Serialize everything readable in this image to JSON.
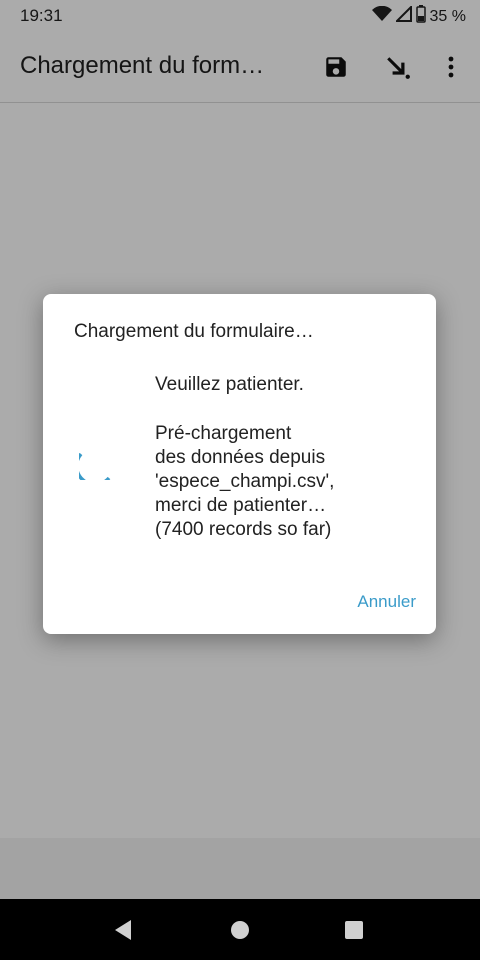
{
  "status_bar": {
    "time": "19:31",
    "battery": "35 %",
    "icons": [
      "wifi-icon",
      "signal-icon",
      "battery-icon"
    ]
  },
  "app_bar": {
    "title": "Chargement du form…",
    "actions": [
      "save-icon",
      "download-arrow-icon",
      "more-vert-icon"
    ]
  },
  "dialog": {
    "title": "Chargement du formulaire…",
    "message_line1": "Veuillez patienter.",
    "message_lines": [
      "Pré-chargement",
      "des données depuis",
      "'espece_champi.csv',",
      "merci de patienter…",
      "(7400 records so far)"
    ],
    "cancel_label": "Annuler"
  },
  "nav_bar": {
    "buttons": [
      "back-icon",
      "home-icon",
      "recents-icon"
    ]
  },
  "colors": {
    "accent": "#3a9bc9",
    "nav_background": "#000000"
  }
}
